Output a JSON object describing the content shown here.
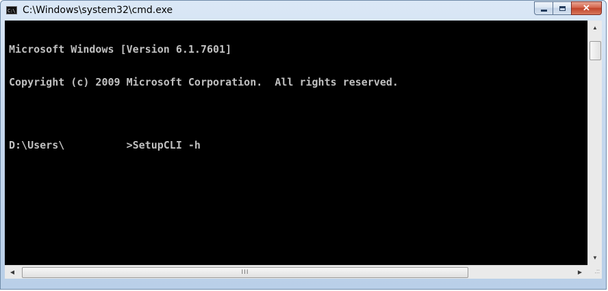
{
  "window": {
    "title": "C:\\Windows\\system32\\cmd.exe",
    "icon_label": "C:\\"
  },
  "caption_buttons": {
    "close_label": "✕"
  },
  "console": {
    "lines": [
      "Microsoft Windows [Version 6.1.7601]",
      "Copyright (c) 2009 Microsoft Corporation.  All rights reserved.",
      "",
      "D:\\Users\\          >SetupCLI -h"
    ]
  },
  "scrollbars": {
    "up_arrow": "▲",
    "down_arrow": "▼",
    "left_arrow": "◀",
    "right_arrow": "▶",
    "grip": "III"
  },
  "size_grip": ".::",
  "colors": {
    "console_bg": "#000000",
    "console_text": "#c0c0c0",
    "close_button": "#c0432a"
  }
}
